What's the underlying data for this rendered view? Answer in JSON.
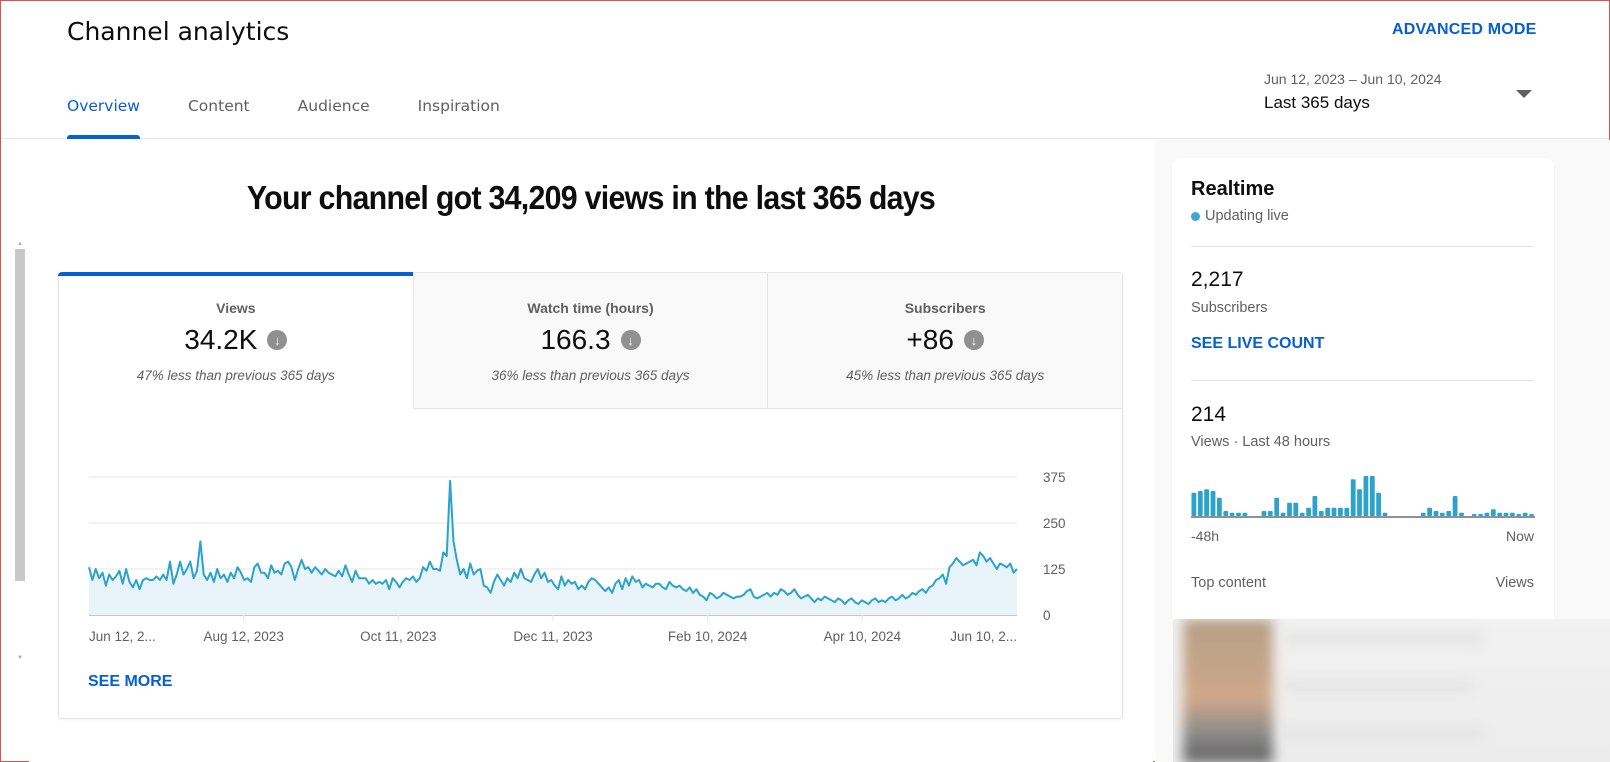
{
  "header": {
    "title": "Channel analytics",
    "advanced_mode": "ADVANCED MODE",
    "tabs": [
      {
        "label": "Overview",
        "active": true
      },
      {
        "label": "Content",
        "active": false
      },
      {
        "label": "Audience",
        "active": false
      },
      {
        "label": "Inspiration",
        "active": false
      }
    ],
    "date_range": {
      "dates": "Jun 12, 2023 – Jun 10, 2024",
      "label": "Last 365 days"
    }
  },
  "main": {
    "headline": "Your channel got 34,209 views in the last 365 days",
    "metrics": [
      {
        "label": "Views",
        "value": "34.2K",
        "trend_icon": "arrow-down-circle-icon",
        "delta": "47% less than previous 365 days"
      },
      {
        "label": "Watch time (hours)",
        "value": "166.3",
        "trend_icon": "arrow-down-circle-icon",
        "delta": "36% less than previous 365 days"
      },
      {
        "label": "Subscribers",
        "value": "+86",
        "trend_icon": "arrow-down-circle-icon",
        "delta": "45% less than previous 365 days"
      }
    ],
    "see_more": "SEE MORE"
  },
  "chart_data": {
    "type": "area",
    "title": "Views",
    "xlabel": "",
    "ylabel": "",
    "x_tick_labels": [
      "Jun 12, 2...",
      "Aug 12, 2023",
      "Oct 11, 2023",
      "Dec 11, 2023",
      "Feb 10, 2024",
      "Apr 10, 2024",
      "Jun 10, 2..."
    ],
    "y_tick_labels": [
      "0",
      "125",
      "250",
      "375"
    ],
    "ylim": [
      0,
      375
    ],
    "y_axis_position": "right",
    "grid": true,
    "color": "#2ba3cc",
    "fill_color": "#e8f4f9",
    "series": [
      {
        "name": "Views",
        "values": [
          130,
          95,
          125,
          100,
          115,
          80,
          110,
          95,
          105,
          120,
          85,
          125,
          90,
          75,
          95,
          70,
          95,
          100,
          95,
          95,
          105,
          95,
          110,
          95,
          145,
          85,
          110,
          145,
          110,
          125,
          145,
          100,
          120,
          200,
          110,
          95,
          115,
          90,
          125,
          100,
          110,
          90,
          115,
          100,
          130,
          115,
          95,
          100,
          90,
          130,
          140,
          115,
          115,
          100,
          135,
          115,
          120,
          110,
          140,
          145,
          130,
          95,
          125,
          150,
          125,
          130,
          115,
          130,
          120,
          110,
          125,
          115,
          110,
          105,
          120,
          105,
          135,
          110,
          90,
          120,
          100,
          100,
          100,
          85,
          95,
          85,
          90,
          85,
          95,
          70,
          100,
          90,
          75,
          90,
          100,
          95,
          105,
          90,
          100,
          130,
          120,
          145,
          125,
          125,
          120,
          170,
          160,
          365,
          200,
          150,
          110,
          125,
          100,
          140,
          110,
          120,
          125,
          80,
          75,
          60,
          90,
          110,
          95,
          80,
          100,
          90,
          115,
          100,
          125,
          100,
          95,
          90,
          110,
          125,
          100,
          115,
          90,
          95,
          80,
          70,
          105,
          80,
          95,
          85,
          90,
          70,
          80,
          70,
          90,
          100,
          95,
          85,
          75,
          65,
          75,
          60,
          85,
          95,
          70,
          100,
          80,
          105,
          90,
          95,
          75,
          85,
          80,
          75,
          85,
          85,
          75,
          70,
          90,
          80,
          75,
          80,
          70,
          65,
          75,
          60,
          70,
          55,
          50,
          40,
          60,
          55,
          45,
          50,
          60,
          55,
          50,
          45,
          50,
          50,
          55,
          65,
          70,
          50,
          45,
          50,
          55,
          60,
          50,
          60,
          55,
          70,
          65,
          55,
          60,
          70,
          55,
          45,
          50,
          55,
          45,
          35,
          45,
          40,
          50,
          45,
          40,
          35,
          45,
          40,
          30,
          40,
          45,
          35,
          30,
          40,
          35,
          30,
          40,
          45,
          35,
          40,
          35,
          45,
          50,
          40,
          45,
          55,
          45,
          50,
          60,
          55,
          65,
          70,
          60,
          75,
          80,
          95,
          100,
          110,
          85,
          130,
          140,
          155,
          145,
          135,
          140,
          145,
          150,
          135,
          170,
          160,
          145,
          155,
          140,
          125,
          140,
          135,
          130,
          140,
          115,
          125
        ]
      }
    ]
  },
  "realtime": {
    "title": "Realtime",
    "status": "Updating live",
    "subscribers_value": "2,217",
    "subscribers_label": "Subscribers",
    "see_live_count": "SEE LIVE COUNT",
    "views_value": "214",
    "views_label": "Views · Last 48 hours",
    "bar_start_label": "-48h",
    "bar_end_label": "Now",
    "hourly_views": [
      7,
      7.5,
      8,
      7.5,
      5.5,
      1.5,
      1,
      1,
      1,
      0,
      0,
      1.5,
      1.5,
      5.5,
      1,
      4,
      4,
      1,
      2.5,
      6,
      1.5,
      2.5,
      2.5,
      2.5,
      2.5,
      11,
      8,
      12,
      12,
      7,
      1,
      0,
      0,
      0,
      0,
      0,
      1,
      2.5,
      1.5,
      1,
      1.5,
      6,
      1,
      0,
      0.5,
      0.5,
      1,
      2,
      1,
      1,
      1,
      0.5,
      1,
      0.5
    ],
    "top_content_label": "Top content",
    "top_views_label": "Views"
  }
}
